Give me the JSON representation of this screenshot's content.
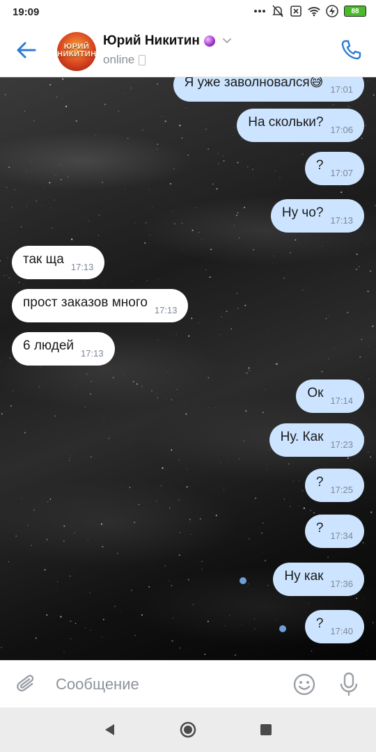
{
  "status_bar": {
    "time": "19:09",
    "battery": "88"
  },
  "header": {
    "contact_name": "Юрий Никитин",
    "avatar_text": "ЮРИЙ НИКИТИН",
    "status": "online"
  },
  "messages": [
    {
      "dir": "out",
      "text": "Я уже заволновался😅",
      "time": "17:01"
    },
    {
      "dir": "out",
      "text": "На скольки?",
      "time": "17:06"
    },
    {
      "dir": "out",
      "text": "?",
      "time": "17:07"
    },
    {
      "dir": "out",
      "text": "Ну чо?",
      "time": "17:13"
    },
    {
      "dir": "in",
      "text": "так ща",
      "time": "17:13"
    },
    {
      "dir": "in",
      "text": "прост заказов много",
      "time": "17:13"
    },
    {
      "dir": "in",
      "text": "6 людей",
      "time": "17:13"
    },
    {
      "dir": "out",
      "text": "Ок",
      "time": "17:14"
    },
    {
      "dir": "out",
      "text": "Ну. Как",
      "time": "17:23"
    },
    {
      "dir": "out",
      "text": "?",
      "time": "17:25"
    },
    {
      "dir": "out",
      "text": "?",
      "time": "17:34"
    },
    {
      "dir": "out",
      "text": "Ну как",
      "time": "17:36",
      "unread": true
    },
    {
      "dir": "out",
      "text": "?",
      "time": "17:40",
      "unread": true
    }
  ],
  "composer": {
    "placeholder": "Сообщение",
    "value": ""
  },
  "colors": {
    "accent": "#2a7ad4",
    "outgoing_bubble": "#cce4ff",
    "incoming_bubble": "#ffffff",
    "unread_dot": "#6f9fd8"
  },
  "icons": [
    "back-arrow-icon",
    "chevron-down-icon",
    "phone-icon",
    "attach-icon",
    "emoji-icon",
    "mic-icon",
    "nav-back-icon",
    "nav-home-icon",
    "nav-recents-icon"
  ]
}
